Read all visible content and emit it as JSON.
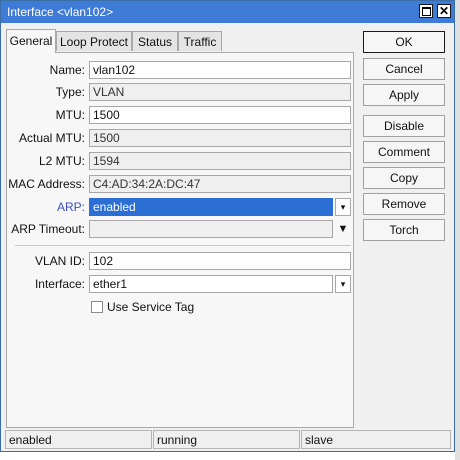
{
  "window": {
    "title": "Interface <vlan102>",
    "close_glyph": "✕"
  },
  "tabs": [
    "General",
    "Loop Protect",
    "Status",
    "Traffic"
  ],
  "fields": {
    "name": {
      "label": "Name:",
      "value": "vlan102"
    },
    "type": {
      "label": "Type:",
      "value": "VLAN"
    },
    "mtu": {
      "label": "MTU:",
      "value": "1500"
    },
    "actual_mtu": {
      "label": "Actual MTU:",
      "value": "1500"
    },
    "l2_mtu": {
      "label": "L2 MTU:",
      "value": "1594"
    },
    "mac": {
      "label": "MAC Address:",
      "value": "C4:AD:34:2A:DC:47"
    },
    "arp": {
      "label": "ARP:",
      "value": "enabled"
    },
    "arp_timeout": {
      "label": "ARP Timeout:",
      "value": ""
    },
    "vlan_id": {
      "label": "VLAN ID:",
      "value": "102"
    },
    "interface": {
      "label": "Interface:",
      "value": "ether1"
    }
  },
  "use_service_tag": {
    "label": "Use Service Tag",
    "checked": false
  },
  "buttons": [
    "OK",
    "Cancel",
    "Apply",
    "Disable",
    "Comment",
    "Copy",
    "Remove",
    "Torch"
  ],
  "status": [
    "enabled",
    "running",
    "slave"
  ],
  "glyphs": {
    "dropdown": "▾",
    "dropdown_plain": "▼"
  },
  "colors": {
    "titlebar": "#3d7bd6",
    "selection": "#2b6ed4",
    "link_label": "#3a4fc6"
  }
}
